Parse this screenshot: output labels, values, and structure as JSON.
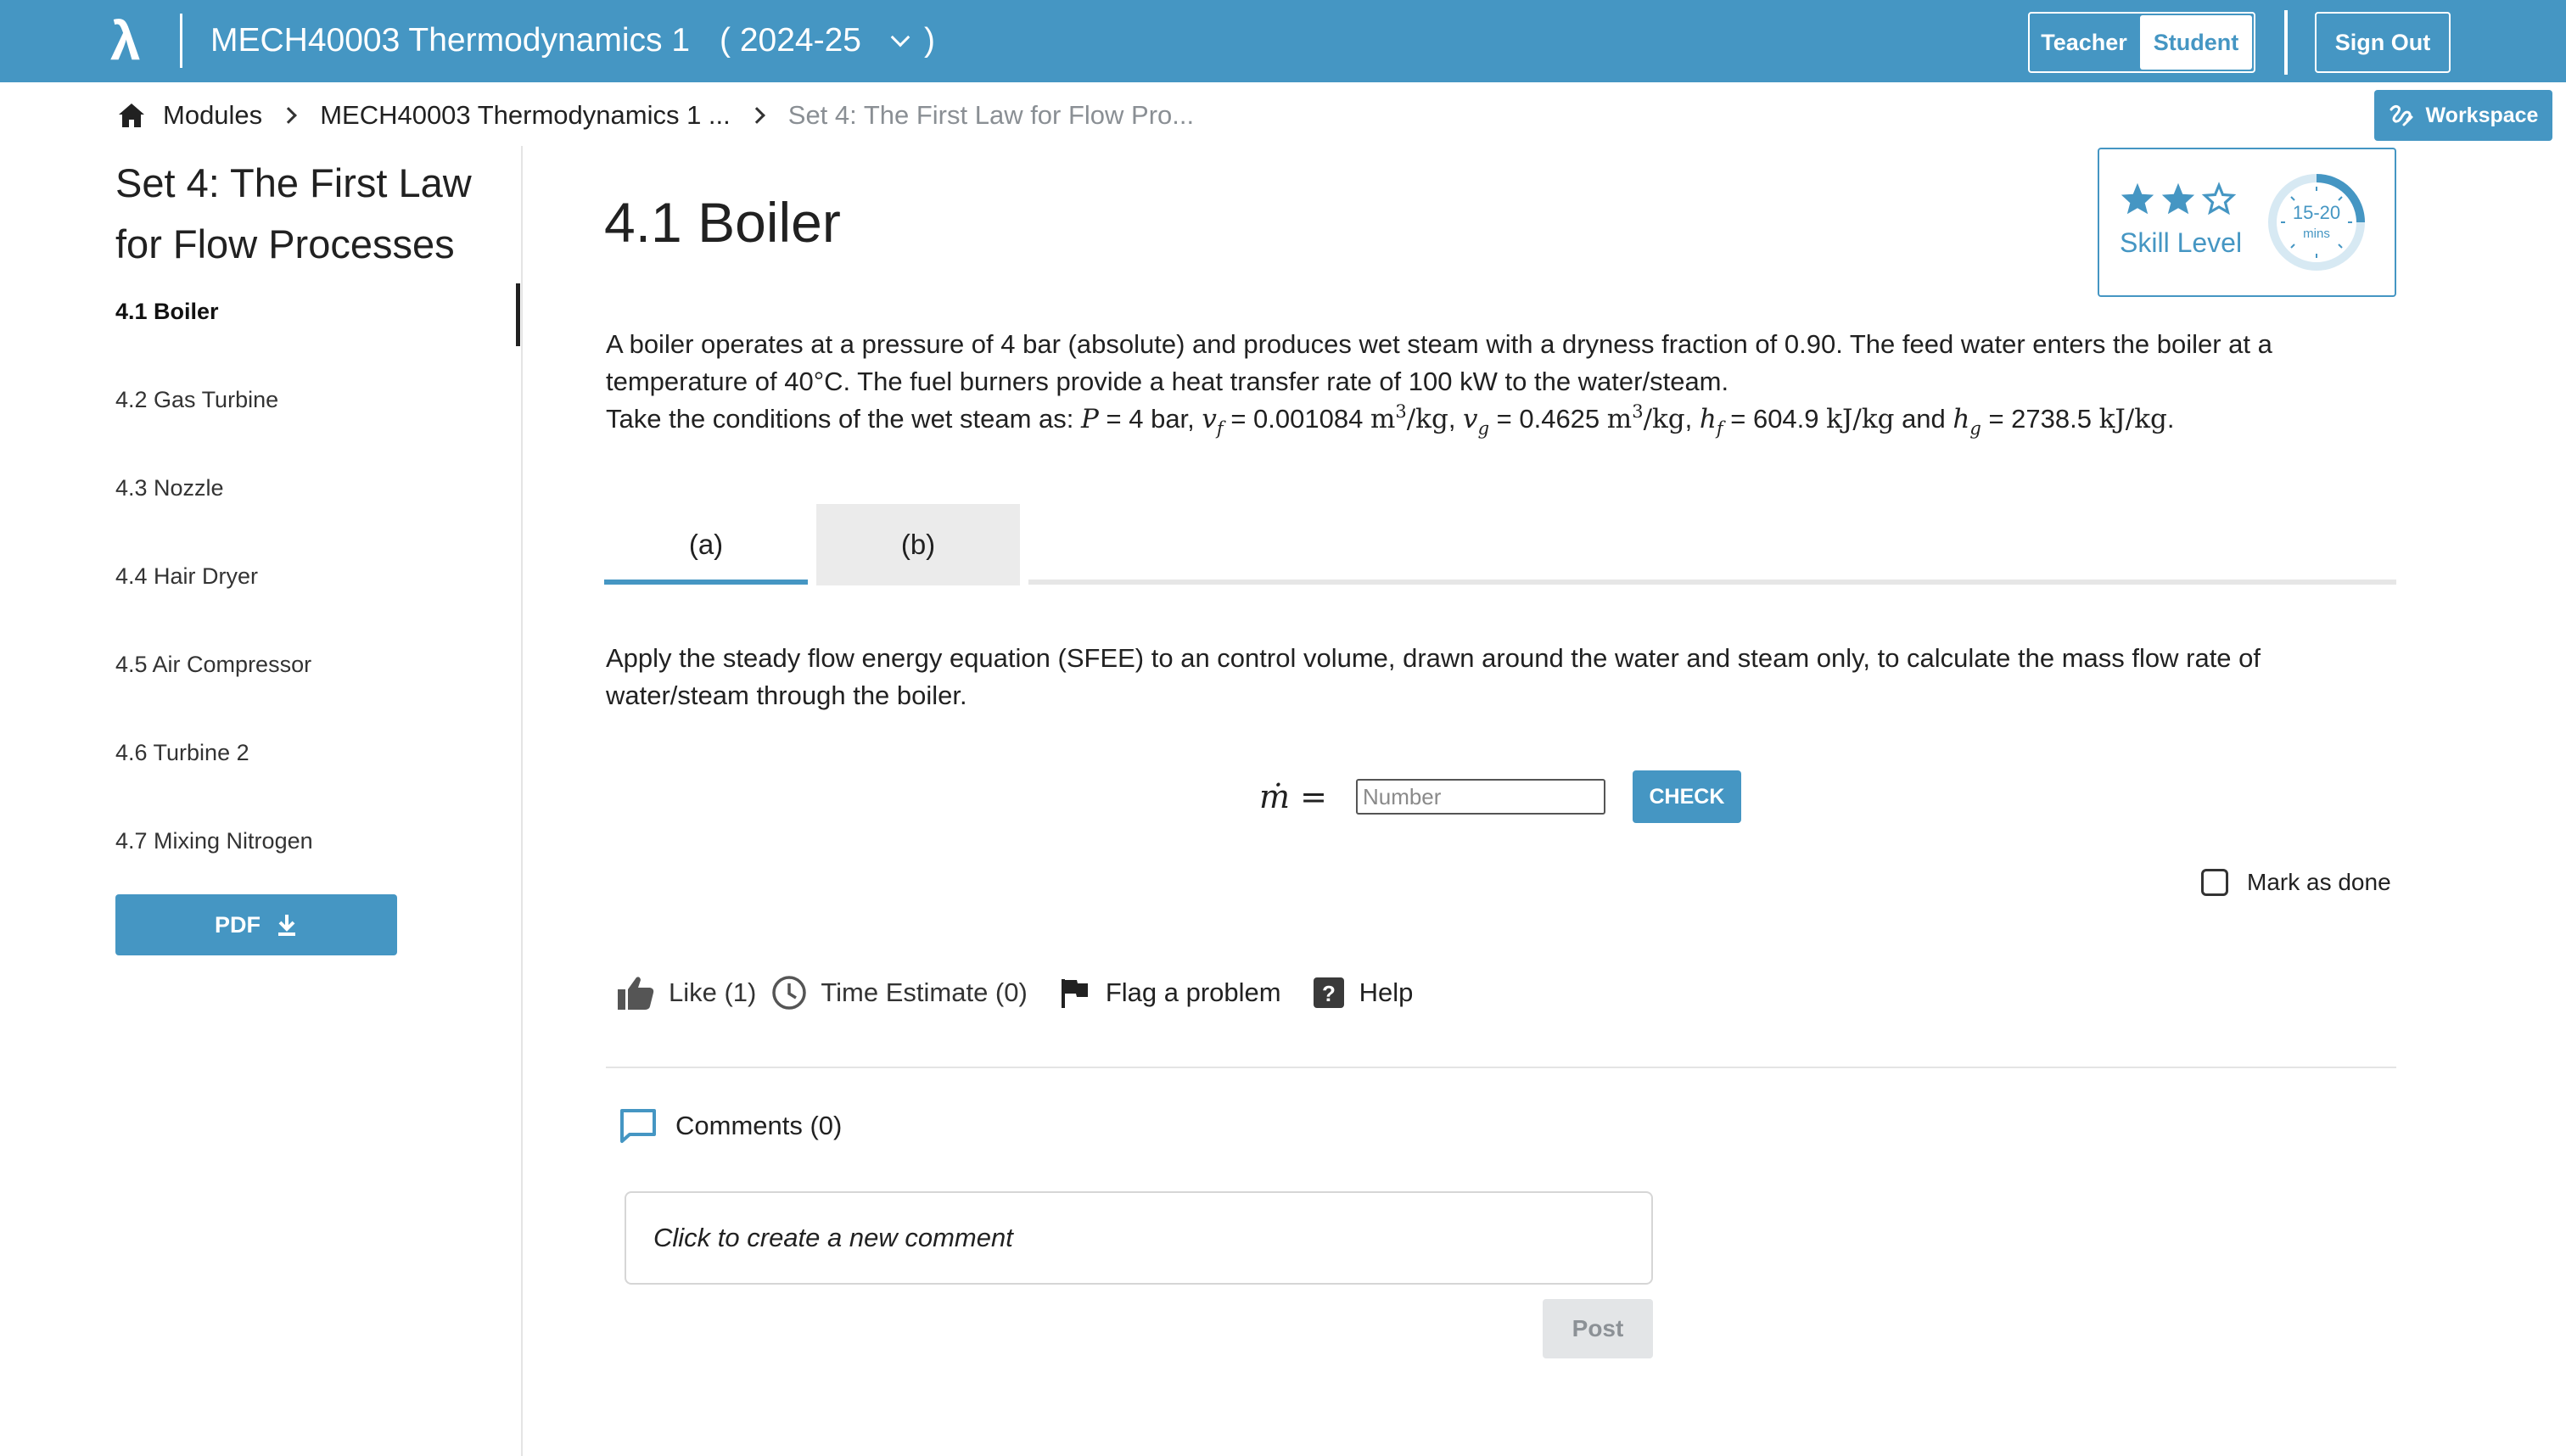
{
  "header": {
    "logo": "λ",
    "course_title": "MECH40003 Thermodynamics 1",
    "year": "( 2024-25",
    "year_close": ")",
    "teacher_label": "Teacher",
    "student_label": "Student",
    "signout_label": "Sign Out"
  },
  "breadcrumb": {
    "items": [
      "Modules",
      "MECH40003 Thermodynamics 1 ...",
      "Set 4: The First Law for Flow Pro..."
    ]
  },
  "workspace_label": "Workspace",
  "sidebar": {
    "set_title": "Set 4: The First Law for Flow Processes",
    "items": [
      {
        "label": "4.1 Boiler"
      },
      {
        "label": "4.2 Gas Turbine"
      },
      {
        "label": "4.3 Nozzle"
      },
      {
        "label": "4.4 Hair Dryer"
      },
      {
        "label": "4.5 Air Compressor"
      },
      {
        "label": "4.6 Turbine 2"
      },
      {
        "label": "4.7 Mixing Nitrogen"
      }
    ],
    "pdf_label": "PDF"
  },
  "main": {
    "title": "4.1 Boiler",
    "skill_level_label": "Skill Level",
    "skill_stars": 2,
    "skill_stars_max": 3,
    "time_range": "15-20",
    "time_unit": "mins",
    "problem_line1": "A boiler operates at a pressure of 4 bar (absolute) and produces wet steam with a dryness fraction of 0.90. The feed water enters the boiler at a",
    "problem_line2": "temperature of 40°C. The fuel burners provide a heat transfer rate of 100 kW to the water/steam.",
    "conditions": {
      "intro": "Take the conditions of the wet steam as: ",
      "p_val": " = 4 bar, ",
      "vf_val": " = 0.001084 ",
      "vg_val": " = 0.4625 ",
      "hf_val": " = 604.9 ",
      "and": " and ",
      "hg_val": " = 2738.5 ",
      "vol_unit": "m",
      "vol_unit_tail": "/kg",
      "energy_unit": "kJ/kg"
    },
    "tabs": [
      {
        "label": "(a)"
      },
      {
        "label": "(b)"
      }
    ],
    "question": "Apply the steady flow energy equation (SFEE) to an control volume, drawn around the water and steam only, to calculate the mass flow rate of water/steam through the boiler.",
    "answer_label": "ṁ =",
    "answer_placeholder": "Number",
    "answer_value": "",
    "check_label": "CHECK",
    "mark_done_label": "Mark as done",
    "actions": {
      "like": "Like (1)",
      "time_estimate": "Time Estimate (0)",
      "flag": "Flag a problem",
      "help": "Help"
    },
    "comments_label": "Comments (0)",
    "comment_placeholder": "Click to create a new comment",
    "post_label": "Post"
  },
  "colors": {
    "brand": "#4596c3",
    "tab_inactive": "#ebebeb",
    "post_disabled": "#e3e5e7"
  }
}
